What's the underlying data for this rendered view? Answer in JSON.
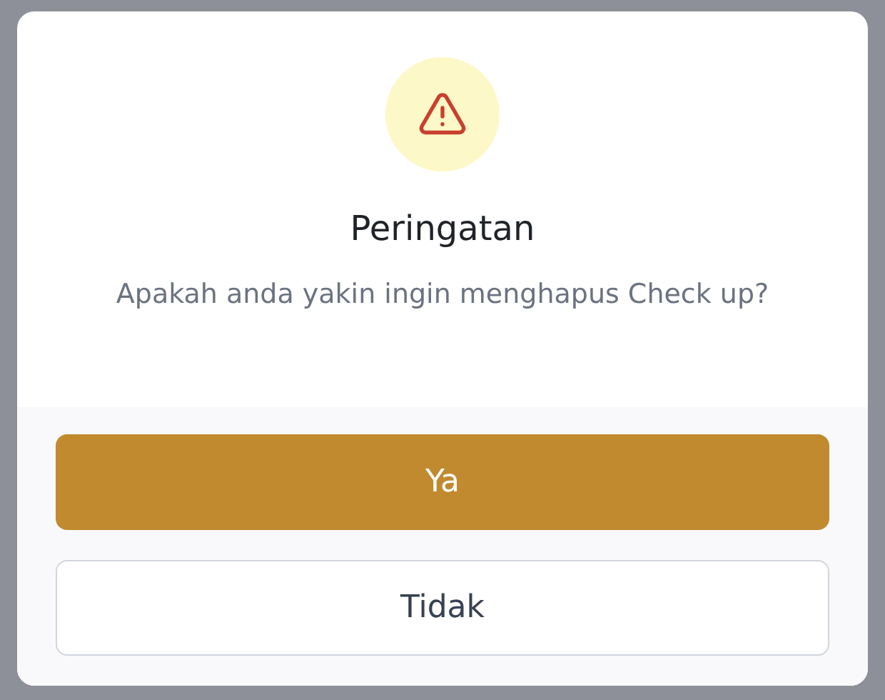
{
  "dialog": {
    "title": "Peringatan",
    "message": "Apakah anda yakin ingin menghapus Check up?"
  },
  "buttons": [
    {
      "label": "Ya",
      "kind": "primary"
    },
    {
      "label": "Tidak",
      "kind": "secondary"
    }
  ]
}
